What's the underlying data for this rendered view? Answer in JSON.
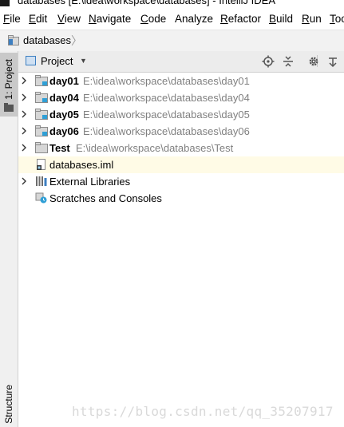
{
  "window": {
    "title": "databases [E:\\idea\\workspace\\databases] - IntelliJ IDEA"
  },
  "menu": [
    {
      "label": "File",
      "mnemonic": "F",
      "rest": "ile"
    },
    {
      "label": "Edit",
      "mnemonic": "E",
      "rest": "dit"
    },
    {
      "label": "View",
      "mnemonic": "V",
      "rest": "iew"
    },
    {
      "label": "Navigate",
      "mnemonic": "N",
      "rest": "avigate"
    },
    {
      "label": "Code",
      "mnemonic": "C",
      "rest": "ode"
    },
    {
      "label": "Analyze",
      "mnemonic": "",
      "rest": "Analyze"
    },
    {
      "label": "Refactor",
      "mnemonic": "R",
      "rest": "efactor"
    },
    {
      "label": "Build",
      "mnemonic": "B",
      "rest": "uild"
    },
    {
      "label": "Run",
      "mnemonic": "R",
      "rest": "un"
    },
    {
      "label": "Too",
      "mnemonic": "T",
      "rest": "oo"
    }
  ],
  "breadcrumb": {
    "label": "databases",
    "separator": "〉"
  },
  "tool_stripe": {
    "top_tab": "1: Project",
    "bottom_tab": "Structure"
  },
  "project_panel": {
    "title": "Project",
    "caret": "▼",
    "toolbar": [
      "target-icon",
      "collapse-icon",
      "gear-icon",
      "hide-icon"
    ]
  },
  "tree": [
    {
      "name": "day01",
      "path": "E:\\idea\\workspace\\databases\\day01",
      "type": "module",
      "bold": true,
      "expandable": true
    },
    {
      "name": "day04",
      "path": "E:\\idea\\workspace\\databases\\day04",
      "type": "module",
      "bold": true,
      "expandable": true
    },
    {
      "name": "day05",
      "path": "E:\\idea\\workspace\\databases\\day05",
      "type": "module",
      "bold": true,
      "expandable": true
    },
    {
      "name": "day06",
      "path": "E:\\idea\\workspace\\databases\\day06",
      "type": "module",
      "bold": true,
      "expandable": true
    },
    {
      "name": "Test",
      "path": "E:\\idea\\workspace\\databases\\Test",
      "type": "folder",
      "bold": true,
      "expandable": true
    },
    {
      "name": "databases.iml",
      "path": "",
      "type": "iml",
      "bold": false,
      "expandable": false,
      "selected": true
    },
    {
      "name": "External Libraries",
      "path": "",
      "type": "libraries",
      "bold": false,
      "expandable": true
    },
    {
      "name": "Scratches and Consoles",
      "path": "",
      "type": "scratches",
      "bold": false,
      "expandable": false
    }
  ],
  "watermark": "https://blog.csdn.net/qq_35207917",
  "colors": {
    "accent": "#3d7fc1",
    "module_marker": "#2f9fd6",
    "path_gray": "#808080",
    "selection": "#fffbe6"
  }
}
